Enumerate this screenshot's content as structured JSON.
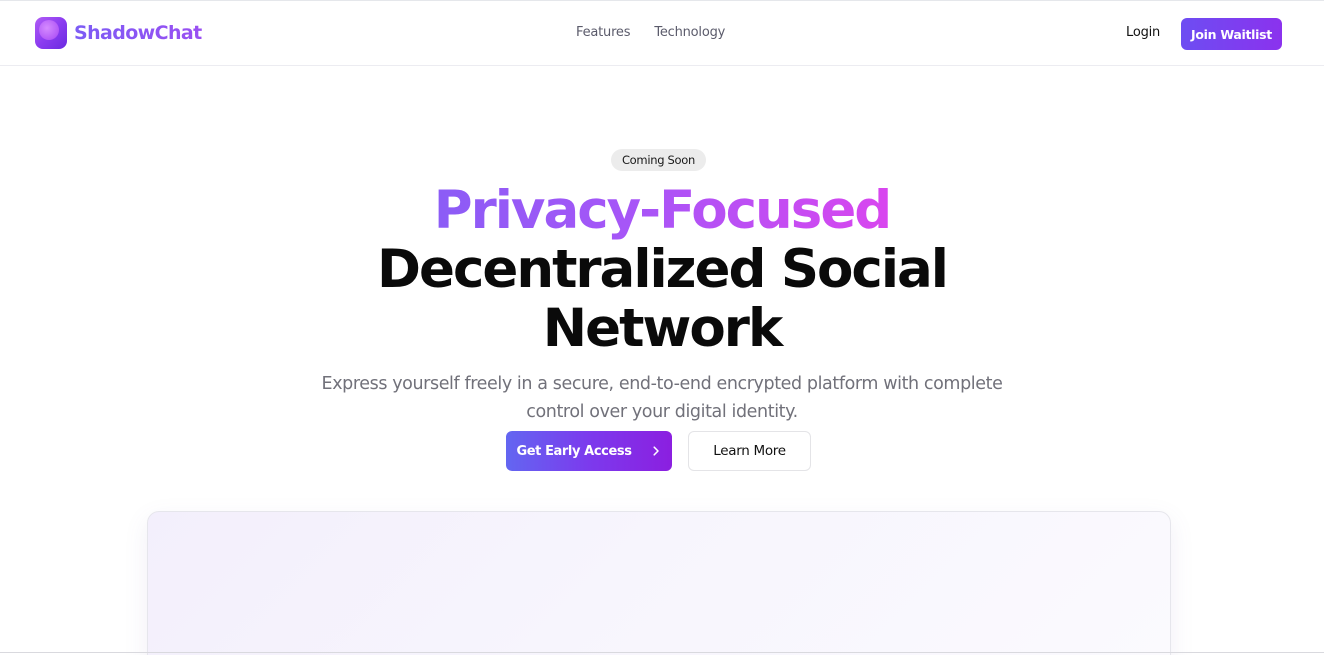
{
  "header": {
    "brand": "ShadowChat",
    "brand_icon": "app-logo-icon",
    "nav": [
      {
        "label": "Features"
      },
      {
        "label": "Technology"
      }
    ],
    "login_label": "Login",
    "join_label": "Join Waitlist"
  },
  "hero": {
    "badge": "Coming Soon",
    "title_gradient": "Privacy-Focused",
    "title_line2": "Decentralized Social",
    "title_line3": "Network",
    "subtitle": "Express yourself freely in a secure, end-to-end encrypted platform with complete control over your digital identity.",
    "primary_cta": "Get Early Access",
    "primary_cta_icon": "chevron-right-icon",
    "secondary_cta": "Learn More"
  },
  "colors": {
    "accent_start": "#6366f1",
    "accent_end": "#8b1fe0",
    "gradient_title_start": "#8b5cf6",
    "gradient_title_end": "#d946ef",
    "text_dark": "#0a0a0a",
    "text_muted": "#71717a"
  }
}
